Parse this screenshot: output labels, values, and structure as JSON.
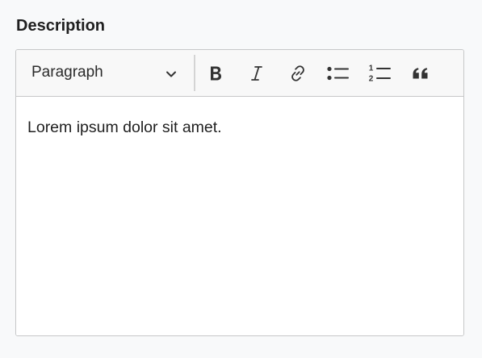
{
  "field": {
    "label": "Description"
  },
  "toolbar": {
    "format_select": {
      "value": "Paragraph",
      "icon": "chevron-down-icon"
    },
    "buttons": [
      {
        "name": "bold",
        "icon": "bold-icon"
      },
      {
        "name": "italic",
        "icon": "italic-icon"
      },
      {
        "name": "link",
        "icon": "link-icon"
      },
      {
        "name": "bulleted-list",
        "icon": "bulleted-list-icon"
      },
      {
        "name": "numbered-list",
        "icon": "numbered-list-icon"
      },
      {
        "name": "blockquote",
        "icon": "quote-icon"
      }
    ],
    "numbered_list_digits": [
      "1",
      "2"
    ]
  },
  "editor": {
    "content": "Lorem ipsum dolor sit amet."
  },
  "colors": {
    "text": "#1f1f1f",
    "icon": "#333333",
    "border": "#c6c7c8",
    "toolbar_bg": "#f8f8f8",
    "page_bg": "#f8f9fa"
  }
}
